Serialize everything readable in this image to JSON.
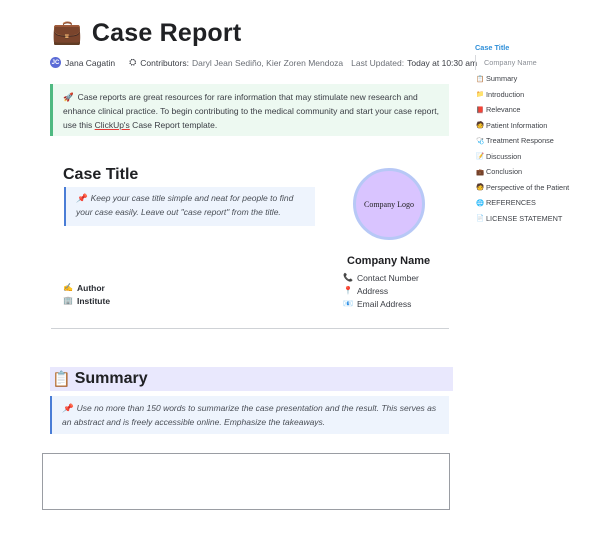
{
  "doc": {
    "title_emoji": "💼",
    "title": "Case Report",
    "meta": {
      "author_initial": "JC",
      "author": "Jana Cagatin",
      "contributors_icon": "contributors-icon",
      "contributors_label": "Contributors:",
      "contributors": "Daryl Jean Sediño, Kier Zoren Mendoza",
      "updated_label": "Last Updated:",
      "updated_value": "Today at 10:30 am"
    },
    "intro_callout": {
      "icon": "🚀",
      "text_before": "Case reports are great resources for rare information that may stimulate new research and enhance clinical practice. To begin contributing to the medical community and start your case report, use this ",
      "link": "ClickUp's",
      "text_after": " Case Report template."
    },
    "case_title": "Case Title",
    "case_callout": {
      "icon": "📌",
      "text": "Keep your case title simple and neat for people to find your case easily. Leave out \"case report\" from the title."
    },
    "logo_text": "Company Logo",
    "company": {
      "name": "Company Name",
      "contacts": [
        {
          "icon": "📞",
          "label": "Contact Number"
        },
        {
          "icon": "📍",
          "label": "Address"
        },
        {
          "icon": "📧",
          "label": "Email Address"
        }
      ]
    },
    "author_block": [
      {
        "icon": "✍️",
        "label": "Author"
      },
      {
        "icon": "🏢",
        "label": "Institute"
      }
    ],
    "summary": {
      "emoji": "📋",
      "title": "Summary",
      "callout_icon": "📌",
      "callout_text": "Use no more than 150 words to summarize the case presentation and the result. This serves as an abstract and is freely accessible online. Emphasize the takeaways."
    }
  },
  "toc": {
    "title": "Case Title",
    "sub": "Company Name",
    "items": [
      {
        "icon": "📋",
        "label": "Summary"
      },
      {
        "icon": "📁",
        "label": "Introduction"
      },
      {
        "icon": "📕",
        "label": "Relevance"
      },
      {
        "icon": "🧑",
        "label": "Patient Information"
      },
      {
        "icon": "🩺",
        "label": "Treatment Response"
      },
      {
        "icon": "📝",
        "label": "Discussion"
      },
      {
        "icon": "💼",
        "label": "Conclusion"
      },
      {
        "icon": "🧑",
        "label": "Perspective of the Patient"
      },
      {
        "icon": "🌐",
        "label": "REFERENCES"
      },
      {
        "icon": "📄",
        "label": "LICENSE STATEMENT"
      }
    ]
  },
  "colors": {
    "accent_blue": "#2f8fd9",
    "callout_green": "#edf9f1",
    "callout_blue": "#eef4fd",
    "summary_bg": "#e9e8fd",
    "logo_fill": "#d9c4ff"
  }
}
